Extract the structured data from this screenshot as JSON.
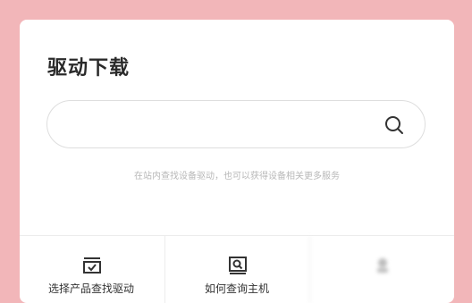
{
  "page": {
    "title": "驱动下载"
  },
  "search": {
    "placeholder": "",
    "value": "",
    "icon": "search-icon"
  },
  "hint": "在站内查找设备驱动，也可以获得设备相关更多服务",
  "quick_links": [
    {
      "label": "选择产品查找驱动",
      "icon": "checklist-icon"
    },
    {
      "label": "如何查询主机",
      "icon": "search-document-icon"
    },
    {
      "label": "",
      "icon": "device-icon"
    }
  ],
  "colors": {
    "background": "#f2b6b9",
    "card": "#ffffff",
    "title": "#2a2a2a",
    "hint": "#b8b8b8"
  }
}
